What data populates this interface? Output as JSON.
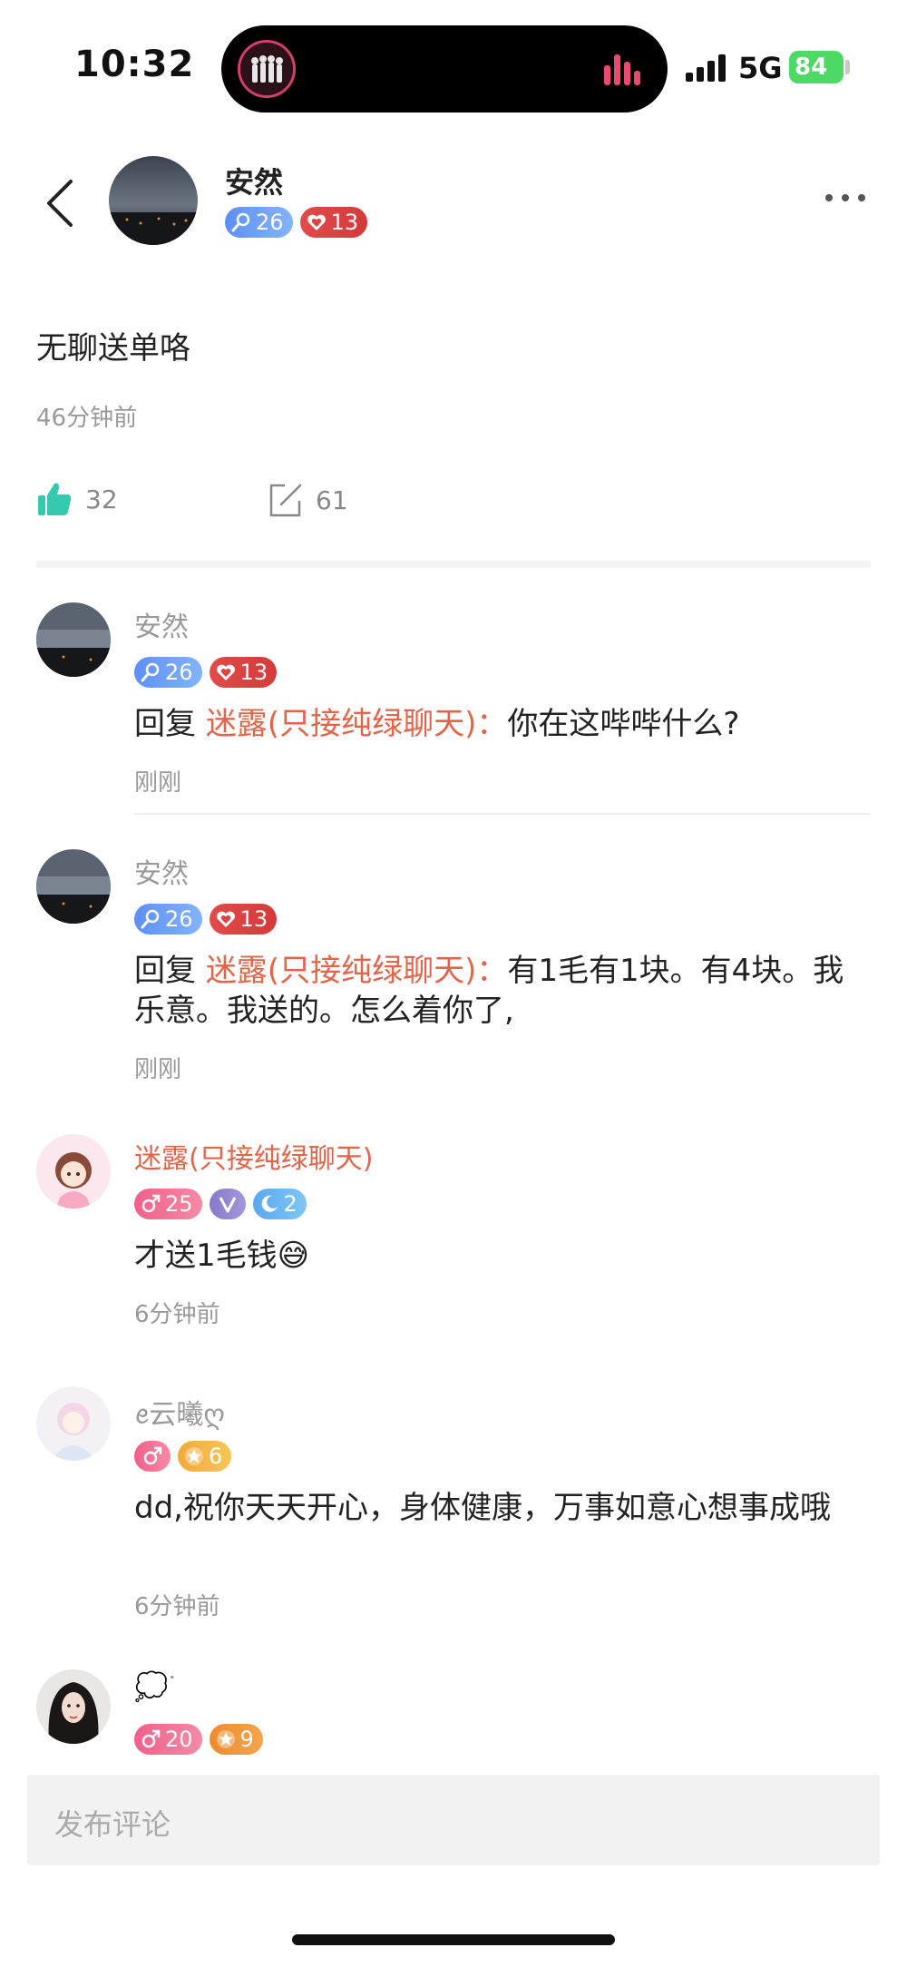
{
  "status_bar": {
    "time": "10:32",
    "network": "5G",
    "battery": "84"
  },
  "post": {
    "author": "安然",
    "badges": [
      {
        "icon": "microphone-icon",
        "value": "26",
        "color": "#6f9ff6"
      },
      {
        "icon": "heart-icon",
        "value": "13",
        "color": "#dd4343"
      }
    ],
    "text": "无聊送单咯",
    "time": "46分钟前",
    "likes": "32",
    "comments": "61"
  },
  "comments": [
    {
      "name": "安然",
      "badges": [
        {
          "icon": "microphone-icon",
          "value": "26"
        },
        {
          "icon": "heart-icon",
          "value": "13"
        }
      ],
      "reply_prefix": "回复 ",
      "mention": "迷露(只接纯绿聊天)：",
      "text": "你在这哔哔什么?",
      "time": "刚刚"
    },
    {
      "name": "安然",
      "badges": [
        {
          "icon": "microphone-icon",
          "value": "26"
        },
        {
          "icon": "heart-icon",
          "value": "13"
        }
      ],
      "reply_prefix": "回复 ",
      "mention": "迷露(只接纯绿聊天)：",
      "text": "有1毛有1块。有4块。我乐意。我送的。怎么着你了,",
      "time": "刚刚"
    },
    {
      "name": "迷露(只接纯绿聊天)",
      "badges": [
        {
          "icon": "male-icon",
          "value": "25"
        },
        {
          "icon": "verified-v-icon",
          "value": ""
        },
        {
          "icon": "moon-icon",
          "value": "2"
        }
      ],
      "text": "才送1毛钱😅",
      "time": "6分钟前"
    },
    {
      "name": "ꫀ云曦ღ",
      "badges": [
        {
          "icon": "male-icon",
          "value": ""
        },
        {
          "icon": "star-icon",
          "value": "6"
        }
      ],
      "text": "dd,祝你天天开心，身体健康，万事如意心想事成哦",
      "time": "6分钟前"
    },
    {
      "name": "💭ᐝ",
      "badges": [
        {
          "icon": "male-icon",
          "value": "20"
        },
        {
          "icon": "star-icon",
          "value": "9"
        }
      ]
    }
  ],
  "input": {
    "placeholder": "发布评论"
  }
}
